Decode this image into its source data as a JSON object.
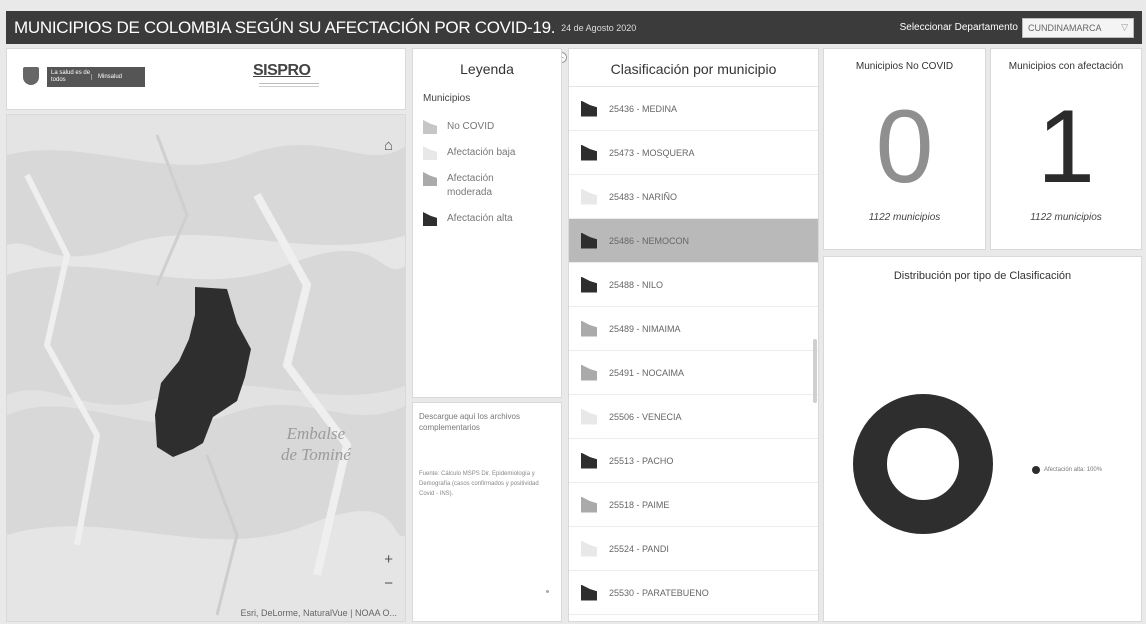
{
  "header": {
    "title": "MUNICIPIOS DE COLOMBIA SEGÚN SU AFECTACIÓN POR COVID-19.",
    "date": "24 de Agosto 2020",
    "select_label": "Seleccionar Departamento",
    "select_value": "CUNDINAMARCA"
  },
  "logos": {
    "gov_line1": "La salud es de todos",
    "gov_line2": "Minsalud",
    "sispro": "SISPRO"
  },
  "map": {
    "water_label_1": "Embalse",
    "water_label_2": "de Tominé",
    "zoom_in": "+",
    "zoom_out": "−",
    "home_icon": "⌂",
    "attribution": "Esri, DeLorme, NaturalVue | NOAA O..."
  },
  "legend": {
    "title": "Leyenda",
    "subtitle": "Municipios",
    "items": [
      {
        "label": "No COVID",
        "class": "nocovid"
      },
      {
        "label": "Afectación baja",
        "class": "baja"
      },
      {
        "label": "Afectación moderada",
        "class": "moderada"
      },
      {
        "label": "Afectación alta",
        "class": "alta"
      }
    ]
  },
  "download": {
    "text": "Descargue aquí los archivos complementarios",
    "source": "Fuente: Cálculo MSPS Dir. Epidemiología y Demografía (casos confirmados y positividad Covid - INS)."
  },
  "list": {
    "title": "Clasificación por municipio",
    "items": [
      {
        "name": "25436 - MEDINA",
        "class": "alta",
        "selected": false
      },
      {
        "name": "25473 - MOSQUERA",
        "class": "alta",
        "selected": false
      },
      {
        "name": "25483 - NARIÑO",
        "class": "baja",
        "selected": false
      },
      {
        "name": "25486 - NEMOCON",
        "class": "alta",
        "selected": true
      },
      {
        "name": "25488 - NILO",
        "class": "alta",
        "selected": false
      },
      {
        "name": "25489 - NIMAIMA",
        "class": "moderada",
        "selected": false
      },
      {
        "name": "25491 - NOCAIMA",
        "class": "moderada",
        "selected": false
      },
      {
        "name": "25506 - VENECIA",
        "class": "baja",
        "selected": false
      },
      {
        "name": "25513 - PACHO",
        "class": "alta",
        "selected": false
      },
      {
        "name": "25518 - PAIME",
        "class": "moderada",
        "selected": false
      },
      {
        "name": "25524 - PANDI",
        "class": "baja",
        "selected": false
      },
      {
        "name": "25530 - PARATEBUENO",
        "class": "alta",
        "selected": false
      }
    ]
  },
  "kpis": {
    "no_covid": {
      "title": "Municipios No COVID",
      "value": "0",
      "foot": "1122 municipios"
    },
    "afectacion": {
      "title": "Municipios con afectación",
      "value": "1",
      "foot": "1122 municipios"
    }
  },
  "donut": {
    "title": "Distribución por tipo de Clasificación",
    "legend": "Afectación alta: 100%"
  },
  "chart_data": {
    "type": "pie",
    "title": "Distribución por tipo de Clasificación",
    "categories": [
      "Afectación alta"
    ],
    "values": [
      100
    ],
    "legend_position": "right"
  },
  "colors": {
    "header_bg": "#3b3b3b",
    "alta": "#2e2e2e",
    "moderada": "#aaaaaa",
    "baja": "#e8e8e8",
    "nocovid": "#c6c6c6"
  }
}
